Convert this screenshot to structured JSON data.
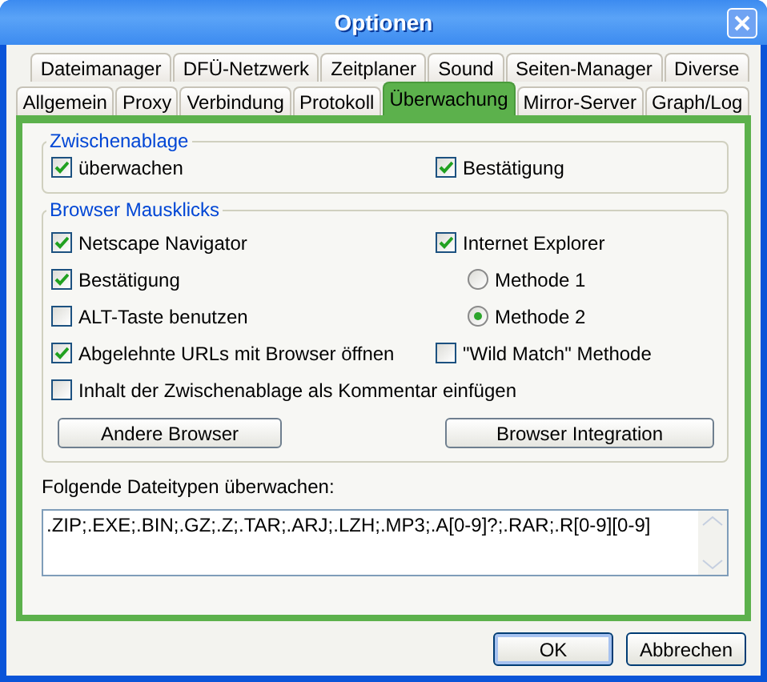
{
  "window": {
    "title": "Optionen"
  },
  "tab_rows": [
    [
      {
        "label": "Dateimanager",
        "selected": false
      },
      {
        "label": "DFÜ-Netzwerk",
        "selected": false
      },
      {
        "label": "Zeitplaner",
        "selected": false
      },
      {
        "label": "Sound",
        "selected": false
      },
      {
        "label": "Seiten-Manager",
        "selected": false
      },
      {
        "label": "Diverse",
        "selected": false
      }
    ],
    [
      {
        "label": "Allgemein",
        "selected": false
      },
      {
        "label": "Proxy",
        "selected": false
      },
      {
        "label": "Verbindung",
        "selected": false
      },
      {
        "label": "Protokoll",
        "selected": false
      },
      {
        "label": "Überwachung",
        "selected": true
      },
      {
        "label": "Mirror-Server",
        "selected": false
      },
      {
        "label": "Graph/Log",
        "selected": false
      }
    ]
  ],
  "clipboard_group": {
    "title": "Zwischenablage",
    "options": [
      {
        "label": "überwachen",
        "checked": true
      },
      {
        "label": "Bestätigung",
        "checked": true
      }
    ]
  },
  "browser_group": {
    "title": "Browser Mausklicks",
    "left_options": [
      {
        "label": "Netscape Navigator",
        "checked": true
      },
      {
        "label": "Bestätigung",
        "checked": true
      },
      {
        "label": "ALT-Taste benutzen",
        "checked": false
      },
      {
        "label": "Abgelehnte URLs mit Browser öffnen",
        "checked": true
      }
    ],
    "right_options": [
      {
        "kind": "checkbox",
        "label": "Internet Explorer",
        "checked": true
      },
      {
        "kind": "radio",
        "label": "Methode 1",
        "selected": false
      },
      {
        "kind": "radio",
        "label": "Methode 2",
        "selected": true
      },
      {
        "kind": "checkbox",
        "label": "\"Wild Match\" Methode",
        "checked": false
      }
    ],
    "wide_option": {
      "label": "Inhalt der Zwischenablage als Kommentar einfügen",
      "checked": false
    },
    "buttons": [
      "Andere Browser",
      "Browser Integration"
    ]
  },
  "filetypes": {
    "label": "Folgende Dateitypen überwachen:",
    "value": ".ZIP;.EXE;.BIN;.GZ;.Z;.TAR;.ARJ;.LZH;.MP3;.A[0-9]?;.RAR;.R[0-9][0-9]"
  },
  "buttons": [
    "OK",
    "Abbrechen"
  ]
}
